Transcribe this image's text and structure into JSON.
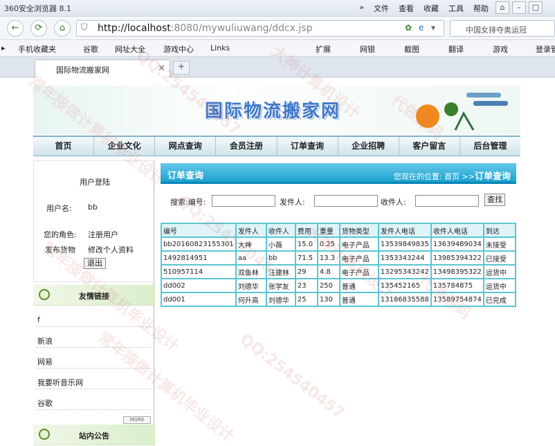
{
  "browser": {
    "title": "360安全浏览器 8.1",
    "menu": [
      "»",
      "文件",
      "查看",
      "收藏",
      "工具",
      "帮助"
    ],
    "url_host": "http://localhost",
    "url_rest": ":8080/mywuliuwang/ddcx.jsp",
    "search_text": "中国女排夺奥运冠",
    "tab_label": "国际物流搬家网",
    "bookmarks": [
      "手机收藏夹",
      "谷歌",
      "网址大全",
      "游戏中心",
      "Links",
      "扩展",
      "网银",
      "截图",
      "翻译",
      "游戏",
      "登录管"
    ]
  },
  "site": {
    "title": "国际物流搬家网",
    "nav": [
      "首页",
      "企业文化",
      "网点查询",
      "会员注册",
      "订单查询",
      "企业招聘",
      "客户留言",
      "后台管理"
    ]
  },
  "login": {
    "header": "用户登陆",
    "username_label": "用户名:",
    "username": "bb",
    "role_label": "您的角色:",
    "role": "注册用户",
    "ship_label": "发布货物",
    "edit_label": "修改个人资料",
    "logout": "退出"
  },
  "friends": {
    "header": "友情链接",
    "links": [
      "f",
      "新浪",
      "网易",
      "我要听音乐网",
      "谷歌"
    ],
    "more": "MORE"
  },
  "notice": {
    "header": "站内公告"
  },
  "orders": {
    "header": "订单查询",
    "location_prefix": "您现在的位置: 首页 >>",
    "location_current": "订单查询",
    "search_label": "搜索:编号:",
    "sender_label": "发件人:",
    "receiver_label": "收件人:",
    "search_button": "查找",
    "columns": [
      "编号",
      "发件人",
      "收件人",
      "费用",
      "重量",
      "货物类型",
      "发件人电话",
      "收件人电话",
      "到达"
    ],
    "rows": [
      [
        "bb20160823155301",
        "大神",
        "小薇",
        "15.0",
        "0.25",
        "电子产品",
        "13539849835",
        "13639489034",
        "未接受"
      ],
      [
        "1492814951",
        "aa",
        "bb",
        "71.5",
        "13.3",
        "电子产品",
        "1353343244",
        "13985394322",
        "已接受"
      ],
      [
        "510957114",
        "双鱼林",
        "汪建林",
        "29",
        "4.8",
        "电子产品",
        "13295343242",
        "13498395322",
        "运货中"
      ],
      [
        "dd002",
        "刘德华",
        "张学友",
        "23",
        "250",
        "普通",
        "135452165",
        "135784875",
        "运货中"
      ],
      [
        "dd001",
        "何升高",
        "刘德华",
        "25",
        "130",
        "普通",
        "13186835588",
        "13589754874",
        "已完成"
      ]
    ]
  },
  "watermarks": [
    "常年接做计算机毕业设计",
    "QQ:254540457",
    "大神计算机设计",
    "代做源码"
  ]
}
